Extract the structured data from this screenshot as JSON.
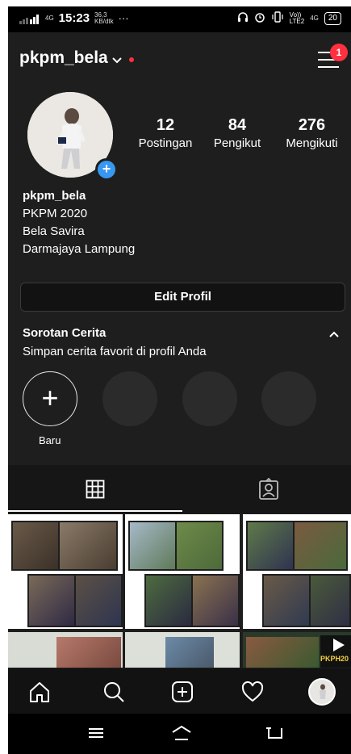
{
  "status_bar": {
    "signal_label": "4G",
    "time": "15:23",
    "speed_value": "36,3",
    "speed_unit": "KB/dtk",
    "more": "···",
    "volte": "Vo))",
    "lte": "LTE2",
    "net": "4G",
    "battery": "20"
  },
  "header": {
    "username": "pkpm_bela",
    "menu_badge": "1"
  },
  "stats": [
    {
      "value": "12",
      "label": "Postingan"
    },
    {
      "value": "84",
      "label": "Pengikut"
    },
    {
      "value": "276",
      "label": "Mengikuti"
    }
  ],
  "bio": {
    "name": "pkpm_bela",
    "line1": "PKPM 2020",
    "line2": "Bela Savira",
    "line3": "Darmajaya Lampung"
  },
  "edit_profile_label": "Edit Profil",
  "highlights": {
    "title": "Sorotan Cerita",
    "subtitle": "Simpan cerita favorit di profil Anda",
    "new_label": "Baru"
  },
  "grid_texts": {
    "banner": "PKPH20"
  },
  "icons": {
    "grid": "grid-icon",
    "tagged": "tagged-icon",
    "home": "home-icon",
    "search": "search-icon",
    "add": "add-post-icon",
    "heart": "heart-icon",
    "profile": "profile-avatar-icon"
  },
  "colors": {
    "background": "#1e1e1e",
    "accent": "#3897f0",
    "notification": "#ff3040"
  }
}
